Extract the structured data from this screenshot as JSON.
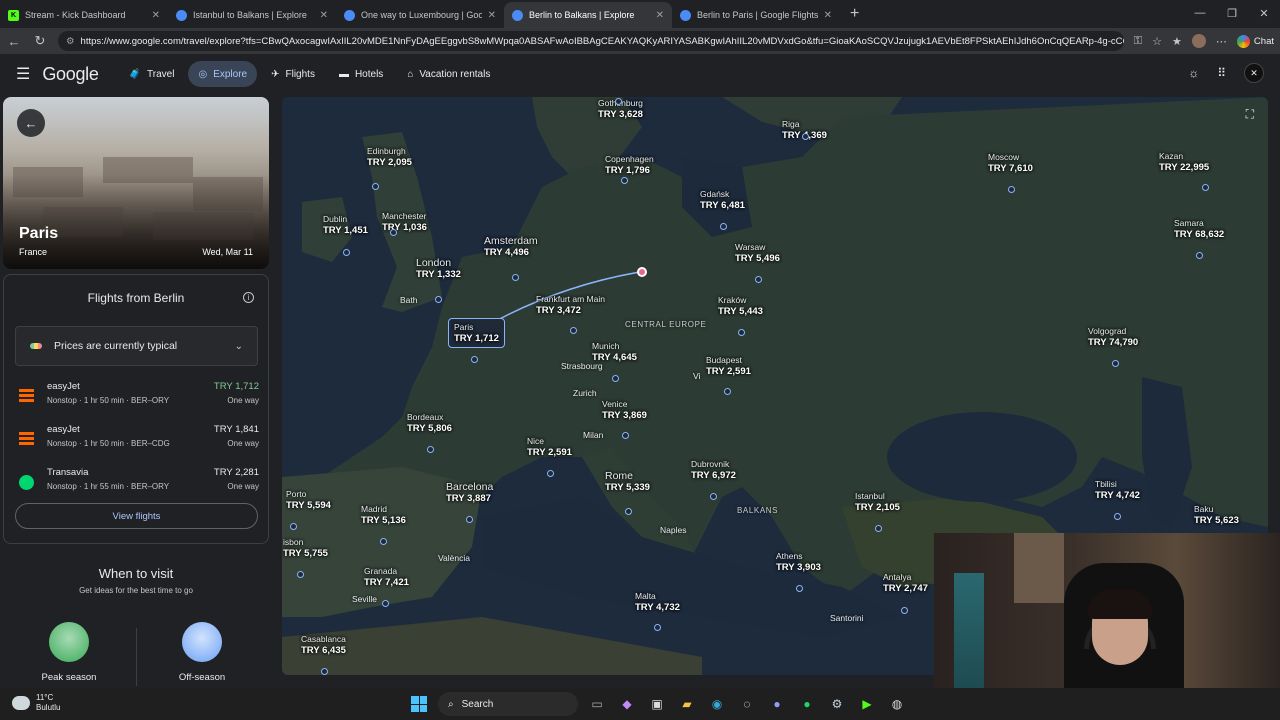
{
  "browser": {
    "tabs": [
      {
        "title": "Stream - Kick Dashboard",
        "icon": "kick-icon"
      },
      {
        "title": "Istanbul to Balkans | Explore",
        "icon": "google-travel-icon"
      },
      {
        "title": "One way to Luxembourg | Google",
        "icon": "google-travel-icon"
      },
      {
        "title": "Berlin to Balkans | Explore",
        "icon": "google-travel-icon",
        "active": true
      },
      {
        "title": "Berlin to Paris | Google Flights",
        "icon": "google-travel-icon"
      }
    ],
    "url": "https://www.google.com/travel/explore?tfs=CBwQAxocagwIAxIIL20vMDE1NnFyDAgEEggvbS8wMWpqa0ABSAFwAoIBBAgCEAKYAQKyARIYASABKgwIAhIIL20vMDVxdGo&tfu=GioaKAoSCQVJzujugk1AEVbEt8FPSktAEhIJdh6OnCqQEARp-4g-cCQJMA&...",
    "chat_label": "Chat"
  },
  "header": {
    "logo": "Google",
    "nav": [
      {
        "label": "Travel",
        "icon": "travel-icon"
      },
      {
        "label": "Explore",
        "icon": "explore-icon",
        "active": true
      },
      {
        "label": "Flights",
        "icon": "plane-icon"
      },
      {
        "label": "Hotels",
        "icon": "hotel-icon"
      },
      {
        "label": "Vacation rentals",
        "icon": "home-icon"
      }
    ]
  },
  "destination": {
    "city": "Paris",
    "country": "France",
    "date": "Wed, Mar 11"
  },
  "flights": {
    "title": "Flights from Berlin",
    "price_status": "Prices are currently typical",
    "items": [
      {
        "airline": "easyJet",
        "details": "Nonstop · 1 hr 50 min · BER–ORY",
        "price": "TRY 1,712",
        "type": "One way",
        "logo": "easyjet-logo",
        "cheapest": true
      },
      {
        "airline": "easyJet",
        "details": "Nonstop · 1 hr 50 min · BER–CDG",
        "price": "TRY 1,841",
        "type": "One way",
        "logo": "easyjet-logo"
      },
      {
        "airline": "Transavia",
        "details": "Nonstop · 1 hr 55 min · BER–ORY",
        "price": "TRY 2,281",
        "type": "One way",
        "logo": "transavia-logo"
      }
    ],
    "view_label": "View flights"
  },
  "visit": {
    "title": "When to visit",
    "subtitle": "Get ideas for the best time to go",
    "peak": "Peak season",
    "off": "Off-season"
  },
  "map": {
    "cities": [
      {
        "name": "Gothenburg",
        "price": "TRY 3,628"
      },
      {
        "name": "Riga",
        "price": "TRY 4,369"
      },
      {
        "name": "Edinburgh",
        "price": "TRY 2,095"
      },
      {
        "name": "Copenhagen",
        "price": "TRY 1,796"
      },
      {
        "name": "Moscow",
        "price": "TRY 7,610"
      },
      {
        "name": "Kazan",
        "price": "TRY 22,995"
      },
      {
        "name": "Gdańsk",
        "price": "TRY 6,481"
      },
      {
        "name": "Dublin",
        "price": "TRY 1,451"
      },
      {
        "name": "Manchester",
        "price": "TRY 1,036"
      },
      {
        "name": "Samara",
        "price": "TRY 68,632"
      },
      {
        "name": "Amsterdam",
        "price": "TRY 4,496"
      },
      {
        "name": "Warsaw",
        "price": "TRY 5,496"
      },
      {
        "name": "London",
        "price": "TRY 1,332"
      },
      {
        "name": "Frankfurt am Main",
        "price": "TRY 3,472"
      },
      {
        "name": "Kraków",
        "price": "TRY 5,443"
      },
      {
        "name": "Paris",
        "price": "TRY 1,712"
      },
      {
        "name": "Volgograd",
        "price": "TRY 74,790"
      },
      {
        "name": "Munich",
        "price": "TRY 4,645"
      },
      {
        "name": "Budapest",
        "price": "TRY 2,591"
      },
      {
        "name": "Venice",
        "price": "TRY 3,869"
      },
      {
        "name": "Bordeaux",
        "price": "TRY 5,806"
      },
      {
        "name": "Nice",
        "price": "TRY 2,591"
      },
      {
        "name": "Dubrovnik",
        "price": "TRY 6,972"
      },
      {
        "name": "Rome",
        "price": "TRY 5,339"
      },
      {
        "name": "Tbilisi",
        "price": "TRY 4,742"
      },
      {
        "name": "Barcelona",
        "price": "TRY 3,887"
      },
      {
        "name": "Istanbul",
        "price": "TRY 2,105"
      },
      {
        "name": "Porto",
        "price": "TRY 5,594"
      },
      {
        "name": "Madrid",
        "price": "TRY 5,136"
      },
      {
        "name": "Baku",
        "price": "TRY 5,623"
      },
      {
        "name": "isbon",
        "price": "TRY 5,755"
      },
      {
        "name": "Athens",
        "price": "TRY 3,903"
      },
      {
        "name": "Granada",
        "price": "TRY 7,421"
      },
      {
        "name": "Antalya",
        "price": "TRY 2,747"
      },
      {
        "name": "Malta",
        "price": "TRY 4,732"
      },
      {
        "name": "Casablanca",
        "price": "TRY 6,435"
      }
    ],
    "places": [
      "Bath",
      "Strasbourg",
      "Zurich",
      "Milan",
      "València",
      "Seville",
      "Naples",
      "Santorini",
      "Vi"
    ],
    "regions": [
      "CENTRAL EUROPE",
      "BALKANS"
    ]
  },
  "taskbar": {
    "temp": "11°C",
    "weather": "Bulutlu",
    "search": "Search"
  }
}
